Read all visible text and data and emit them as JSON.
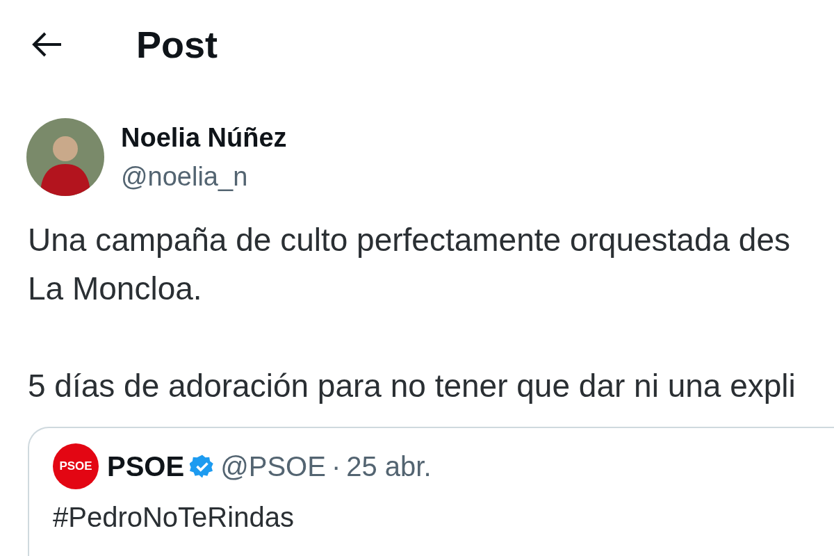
{
  "header": {
    "title": "Post"
  },
  "post": {
    "author_name": "Noelia Núñez",
    "author_handle": "@noelia_n",
    "paragraphs": [
      [
        "Una campaña de culto perfectamente orquestada des",
        "La Moncloa."
      ],
      [
        "5 días de adoración para no tener que dar ni una expli"
      ]
    ]
  },
  "quoted_post": {
    "logo_text": "PSOE",
    "author_name": "PSOE",
    "verified": true,
    "author_handle": "@PSOE",
    "separator": "·",
    "date": "25 abr.",
    "text": "#PedroNoTeRindas"
  }
}
